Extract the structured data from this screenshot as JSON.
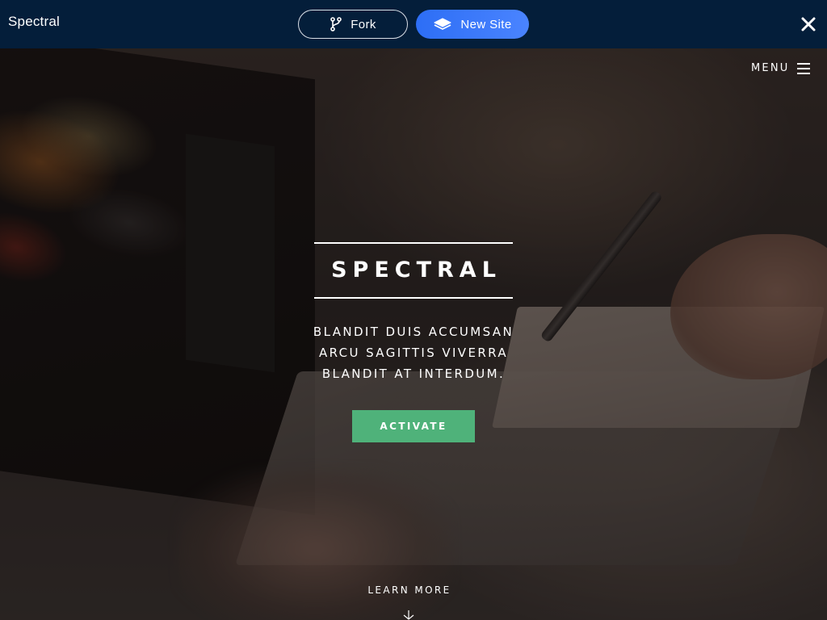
{
  "topbar": {
    "brand": "Spectral",
    "fork_label": "Fork",
    "new_site_label": "New Site",
    "colors": {
      "background": "#041e3a",
      "new_site_accent": "#3b7bff"
    },
    "icons": {
      "fork": "git-fork-icon",
      "new_site": "layers-icon",
      "close": "close-icon"
    }
  },
  "hero": {
    "menu_label": "MENU",
    "title": "SPECTRAL",
    "subtitle_lines": [
      "BLANDIT DUIS ACCUMSAN",
      "ARCU SAGITTIS VIVERRA",
      "BLANDIT AT INTERDUM."
    ],
    "cta_label": "ACTIVATE",
    "learn_more_label": "LEARN MORE",
    "colors": {
      "cta": "#4fb27a",
      "text": "#ffffff"
    },
    "icons": {
      "menu": "hamburger-icon",
      "scroll": "chevron-down-icon"
    },
    "background_image": "laptop-and-drawing-tablet-photo"
  }
}
